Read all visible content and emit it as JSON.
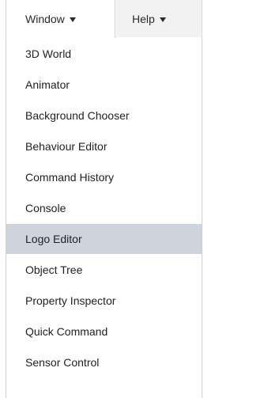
{
  "menubar": {
    "window_label": "Window",
    "help_label": "Help"
  },
  "window_menu": {
    "items": [
      {
        "label": "3D World"
      },
      {
        "label": "Animator"
      },
      {
        "label": "Background Chooser"
      },
      {
        "label": "Behaviour Editor"
      },
      {
        "label": "Command History"
      },
      {
        "label": "Console"
      },
      {
        "label": "Logo Editor",
        "selected": true
      },
      {
        "label": "Object Tree"
      },
      {
        "label": "Property Inspector"
      },
      {
        "label": "Quick Command"
      },
      {
        "label": "Sensor Control"
      }
    ],
    "highlight_color": "#cfd3db"
  }
}
